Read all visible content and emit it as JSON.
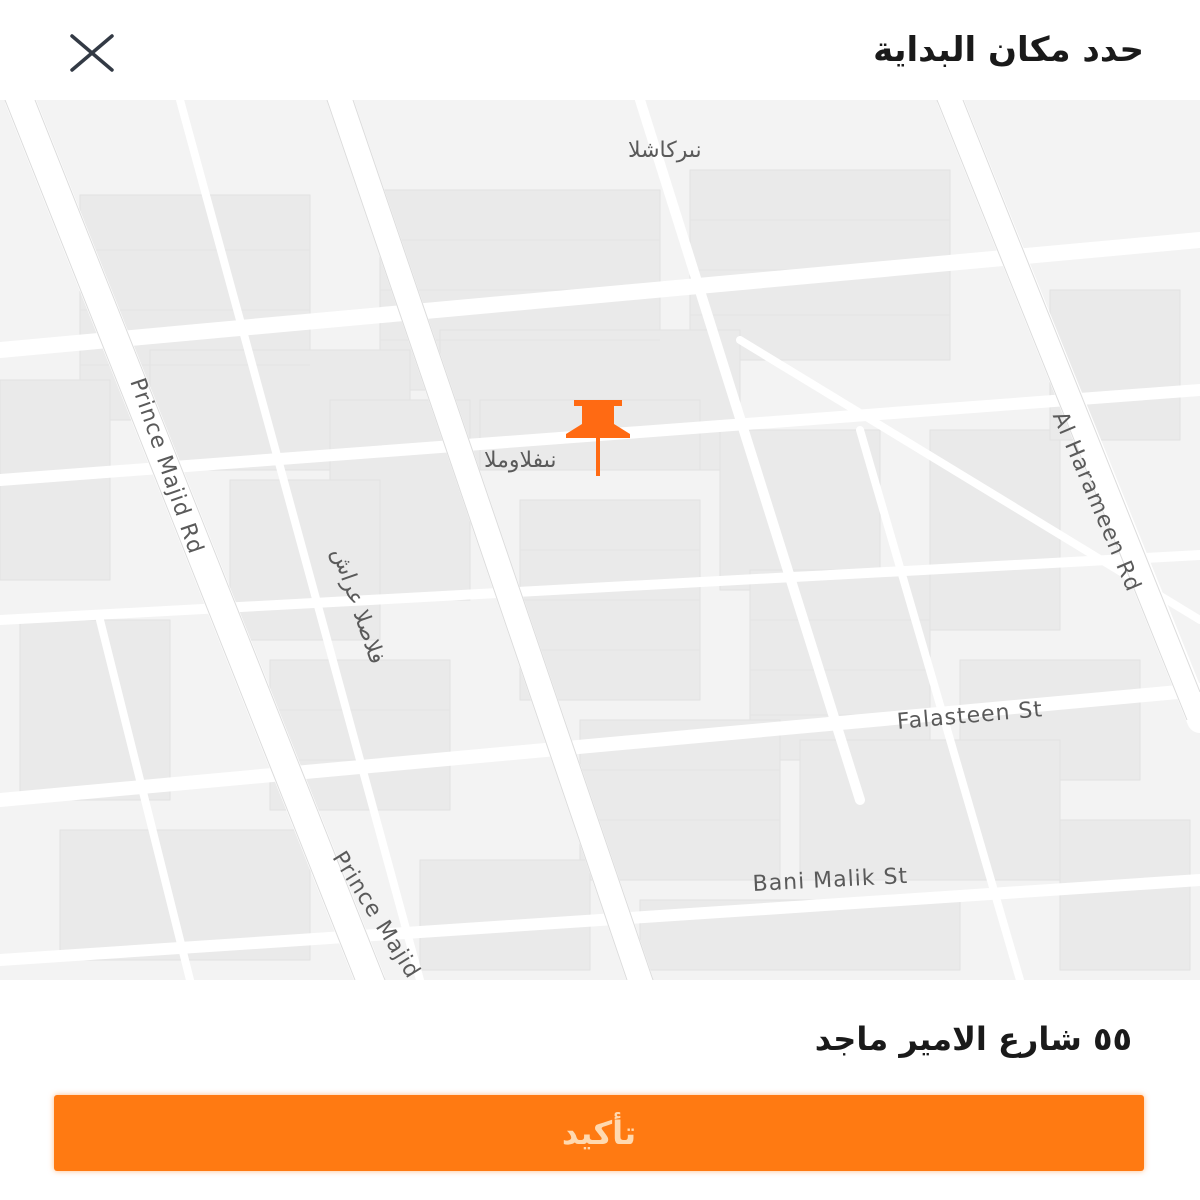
{
  "header": {
    "title": "حدد مكان البداية",
    "close_icon": "close-icon"
  },
  "map": {
    "street_labels": [
      "نىركاشلا",
      "نىفلاوملا",
      "Prince Majid Rd",
      "فلاصلا عراش",
      "Al Harameen Rd",
      "Falasteen St",
      "Bani Malik St",
      "Prince Majid Rd"
    ],
    "pin_icon": "map-pin-icon",
    "pin_color": "#ff6a13"
  },
  "footer": {
    "address": "٥٥ شارع الامير ماجد",
    "confirm_label": "تأكيد",
    "accent_color": "#ff7a12"
  }
}
